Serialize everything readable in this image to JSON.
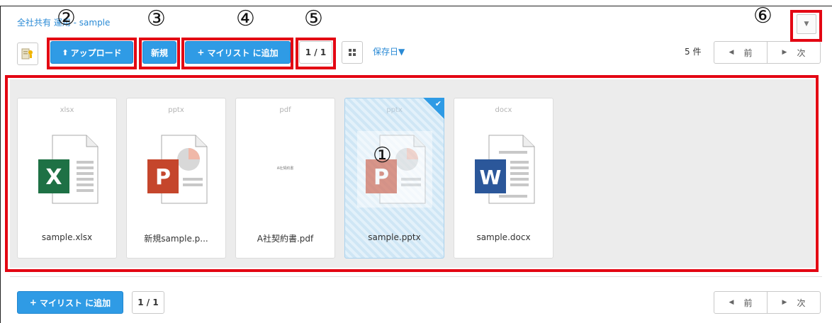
{
  "breadcrumb": "全社共有 運用 - sample",
  "toolbar": {
    "upload_label": "アップロード",
    "new_label": "新規",
    "add_mylist_label": "マイリスト に追加",
    "page_indicator": "1 / 1",
    "sort_label": "保存日▼"
  },
  "count_label": "5 件",
  "pager": {
    "prev": "前",
    "next": "次"
  },
  "annotations": {
    "a1": "①",
    "a2": "②",
    "a3": "③",
    "a4": "④",
    "a5": "⑤",
    "a6": "⑥"
  },
  "files": [
    {
      "ext": "xlsx",
      "name": "sample.xlsx",
      "type": "excel",
      "selected": false
    },
    {
      "ext": "pptx",
      "name": "新規sample.p...",
      "type": "powerpoint",
      "selected": false
    },
    {
      "ext": "pdf",
      "name": "A社契約書.pdf",
      "type": "pdf",
      "selected": false,
      "thumb_text": "A社契約書"
    },
    {
      "ext": "pptx",
      "name": "sample.pptx",
      "type": "powerpoint",
      "selected": true
    },
    {
      "ext": "docx",
      "name": "sample.docx",
      "type": "word",
      "selected": false
    }
  ],
  "bottom": {
    "add_mylist_label": "マイリスト に追加",
    "page_indicator": "1 / 1"
  },
  "colors": {
    "accent": "#2f9be5",
    "highlight": "#e30613",
    "excel": "#1e7145",
    "powerpoint": "#c5462c",
    "word": "#2b579a"
  }
}
